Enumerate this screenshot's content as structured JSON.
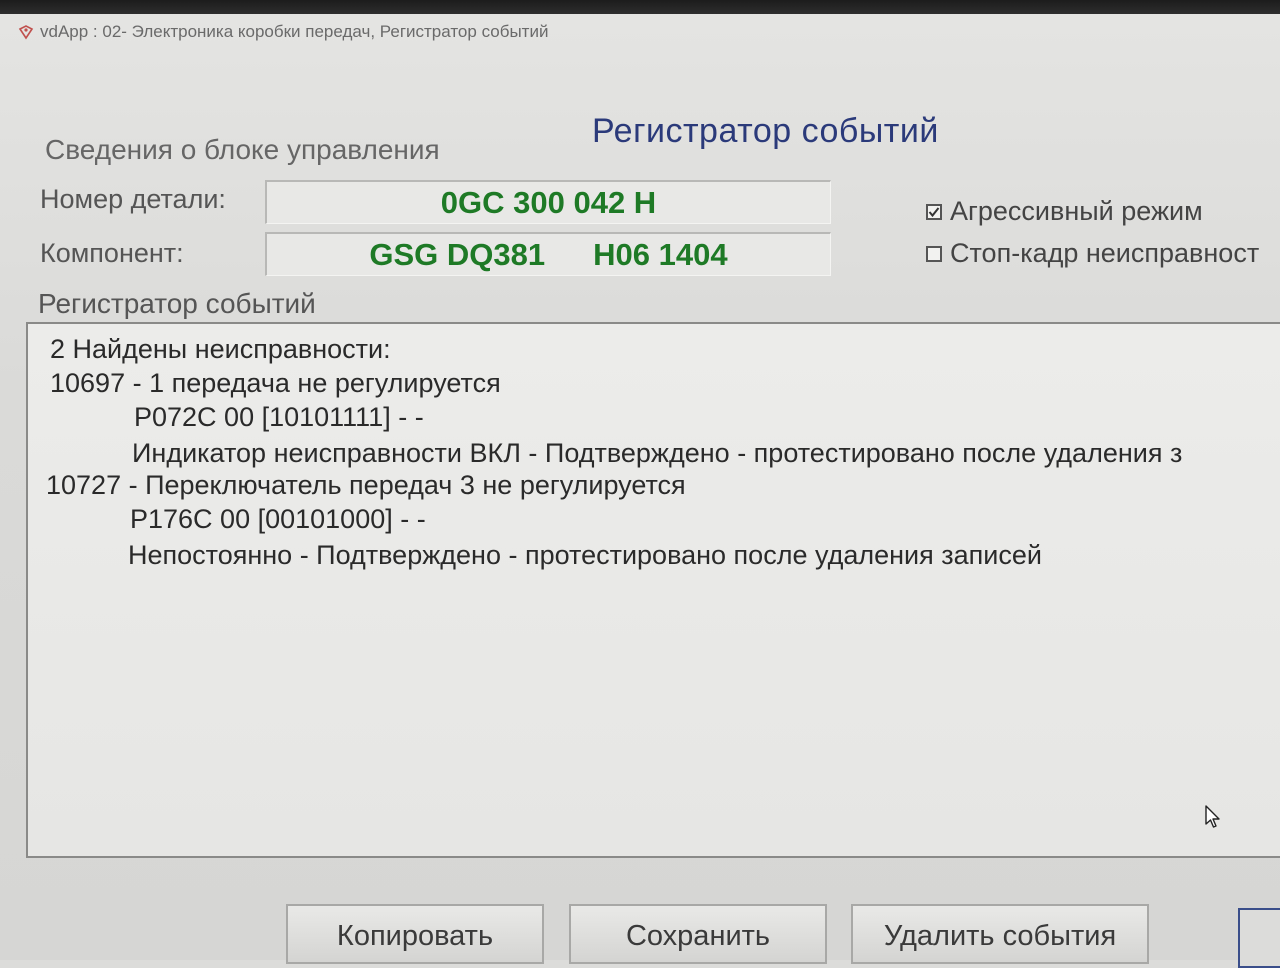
{
  "window": {
    "title": "vdApp : 02- Электроника коробки передач,  Регистратор событий"
  },
  "header": {
    "title": "Регистратор событий"
  },
  "ecu_info": {
    "section_label": "Сведения о блоке управления",
    "part_number_label": "Номер детали:",
    "part_number_value": "0GC 300 042 H",
    "component_label": "Компонент:",
    "component_name": "GSG DQ381",
    "component_version": "H06 1404"
  },
  "options": {
    "aggressive_mode_label": "Агрессивный режим",
    "aggressive_mode_checked": true,
    "freeze_frame_label": "Стоп-кадр неисправност",
    "freeze_frame_checked": false
  },
  "event_log": {
    "label": "Регистратор событий",
    "lines": [
      "2 Найдены неисправности:",
      "10697 - 1 передача не регулируется",
      "P072C 00 [10101111] - -",
      "Индикатор неисправности ВКЛ - Подтверждено - протестировано после удаления з",
      "10727 - Переключатель передач 3 не регулируется",
      "P176C 00 [00101000] - -",
      "Непостоянно - Подтверждено - протестировано после удаления записей"
    ]
  },
  "buttons": {
    "copy": "Копировать",
    "save": "Сохранить",
    "delete": "Удалить события"
  },
  "icons": {
    "app": "app-icon",
    "mouse_cursor": "mouse-pointer-icon",
    "check": "checkmark-icon"
  },
  "colors": {
    "title_blue": "#2b3a7a",
    "value_green": "#1e7a26"
  }
}
